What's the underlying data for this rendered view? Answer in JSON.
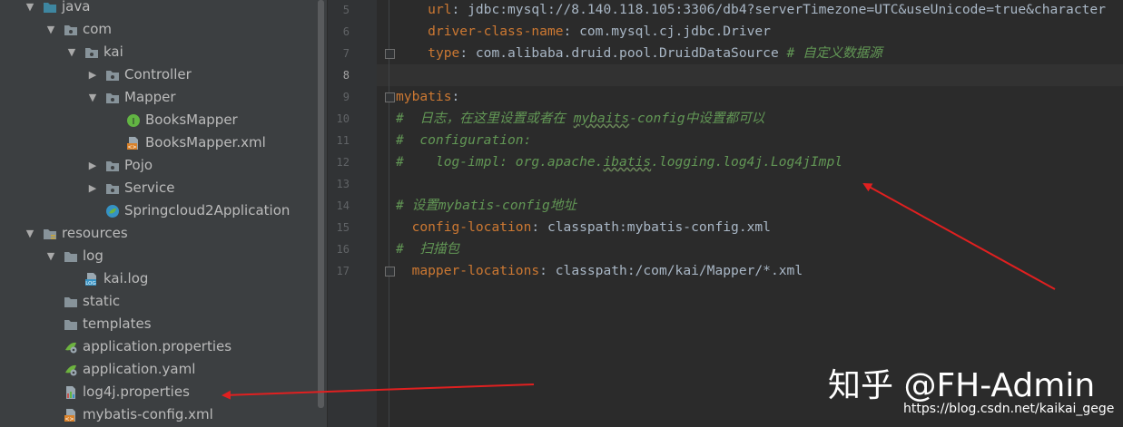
{
  "tree": [
    {
      "label": "java",
      "arrow": "open",
      "icon": "folder-icon",
      "icon_color": "#3e86a0"
    },
    {
      "label": "com",
      "arrow": "open",
      "icon": "package-icon"
    },
    {
      "label": "kai",
      "arrow": "open",
      "icon": "package-icon"
    },
    {
      "label": "Controller",
      "arrow": "closed",
      "icon": "package-icon"
    },
    {
      "label": "Mapper",
      "arrow": "open",
      "icon": "package-icon"
    },
    {
      "label": "BooksMapper",
      "arrow": "",
      "icon": "interface-icon"
    },
    {
      "label": "BooksMapper.xml",
      "arrow": "",
      "icon": "xml-file-icon"
    },
    {
      "label": "Pojo",
      "arrow": "closed",
      "icon": "package-icon"
    },
    {
      "label": "Service",
      "arrow": "closed",
      "icon": "package-icon"
    },
    {
      "label": "Springcloud2Application",
      "arrow": "",
      "icon": "spring-boot-class-icon"
    },
    {
      "label": "resources",
      "arrow": "open",
      "icon": "resources-folder-icon"
    },
    {
      "label": "log",
      "arrow": "open",
      "icon": "folder-icon"
    },
    {
      "label": "kai.log",
      "arrow": "",
      "icon": "log-file-icon"
    },
    {
      "label": "static",
      "arrow": "",
      "icon": "folder-icon"
    },
    {
      "label": "templates",
      "arrow": "",
      "icon": "folder-icon"
    },
    {
      "label": "application.properties",
      "arrow": "",
      "icon": "spring-config-icon"
    },
    {
      "label": "application.yaml",
      "arrow": "",
      "icon": "spring-config-icon"
    },
    {
      "label": "log4j.properties",
      "arrow": "",
      "icon": "properties-file-icon"
    },
    {
      "label": "mybatis-config.xml",
      "arrow": "",
      "icon": "xml-file-icon"
    }
  ],
  "editor": {
    "current_line": 8,
    "lines": [
      {
        "n": 5,
        "fold": false,
        "tokens": [
          {
            "t": "    "
          },
          {
            "t": "url",
            "k": "k"
          },
          {
            "t": ": jdbc:mysql://8.140.118.105:3306/db4?serverTimezone=UTC&useUnicode=true&character",
            "k": "v"
          }
        ]
      },
      {
        "n": 6,
        "fold": false,
        "tokens": [
          {
            "t": "    "
          },
          {
            "t": "driver-class-name",
            "k": "k"
          },
          {
            "t": ": com.mysql.cj.jdbc.Driver",
            "k": "v"
          }
        ]
      },
      {
        "n": 7,
        "fold": true,
        "tokens": [
          {
            "t": "    "
          },
          {
            "t": "type",
            "k": "k"
          },
          {
            "t": ": com.alibaba.druid.pool.DruidDataSource ",
            "k": "v"
          },
          {
            "t": "# 自定义数据源",
            "k": "c"
          }
        ]
      },
      {
        "n": 8,
        "fold": false,
        "tokens": []
      },
      {
        "n": 9,
        "fold": true,
        "tokens": [
          {
            "t": "mybatis",
            "k": "k"
          },
          {
            "t": ":",
            "k": "p"
          }
        ]
      },
      {
        "n": 10,
        "fold": false,
        "tokens": [
          {
            "t": "#  日志，在这里设置或者在 ",
            "k": "c"
          },
          {
            "t": "mybaits",
            "k": "c",
            "typo": true
          },
          {
            "t": "-config中设置都可以",
            "k": "c"
          }
        ]
      },
      {
        "n": 11,
        "fold": false,
        "tokens": [
          {
            "t": "#  configuration:",
            "k": "c"
          }
        ]
      },
      {
        "n": 12,
        "fold": false,
        "tokens": [
          {
            "t": "#    log-impl: org.apache.",
            "k": "c"
          },
          {
            "t": "ibatis",
            "k": "c",
            "typo": true
          },
          {
            "t": ".logging.log4j.Log4jImpl",
            "k": "c"
          }
        ]
      },
      {
        "n": 13,
        "fold": false,
        "tokens": []
      },
      {
        "n": 14,
        "fold": false,
        "tokens": [
          {
            "t": "# 设置mybatis-config地址",
            "k": "c"
          }
        ]
      },
      {
        "n": 15,
        "fold": false,
        "tokens": [
          {
            "t": "  "
          },
          {
            "t": "config-location",
            "k": "k"
          },
          {
            "t": ": classpath:mybatis-config.xml",
            "k": "v"
          }
        ]
      },
      {
        "n": 16,
        "fold": false,
        "tokens": [
          {
            "t": "#  扫描包",
            "k": "c"
          }
        ]
      },
      {
        "n": 17,
        "fold": true,
        "tokens": [
          {
            "t": "  "
          },
          {
            "t": "mapper-locations",
            "k": "k"
          },
          {
            "t": ": classpath:/com/kai/Mapper/*.xml",
            "k": "v"
          }
        ]
      }
    ]
  },
  "annotation_arrows": [
    {
      "target": "line-12-log-impl",
      "color": "#e02020"
    },
    {
      "target": "tree-log4j-properties",
      "color": "#e02020"
    }
  ],
  "watermark": {
    "title": "知乎 @FH-Admin",
    "url": "https://blog.csdn.net/kaikai_gege"
  },
  "colors": {
    "keyword": "#cc7832",
    "value": "#a9b7c6",
    "comment": "#629755",
    "background": "#2b2b2b",
    "panel": "#3c3f41"
  }
}
